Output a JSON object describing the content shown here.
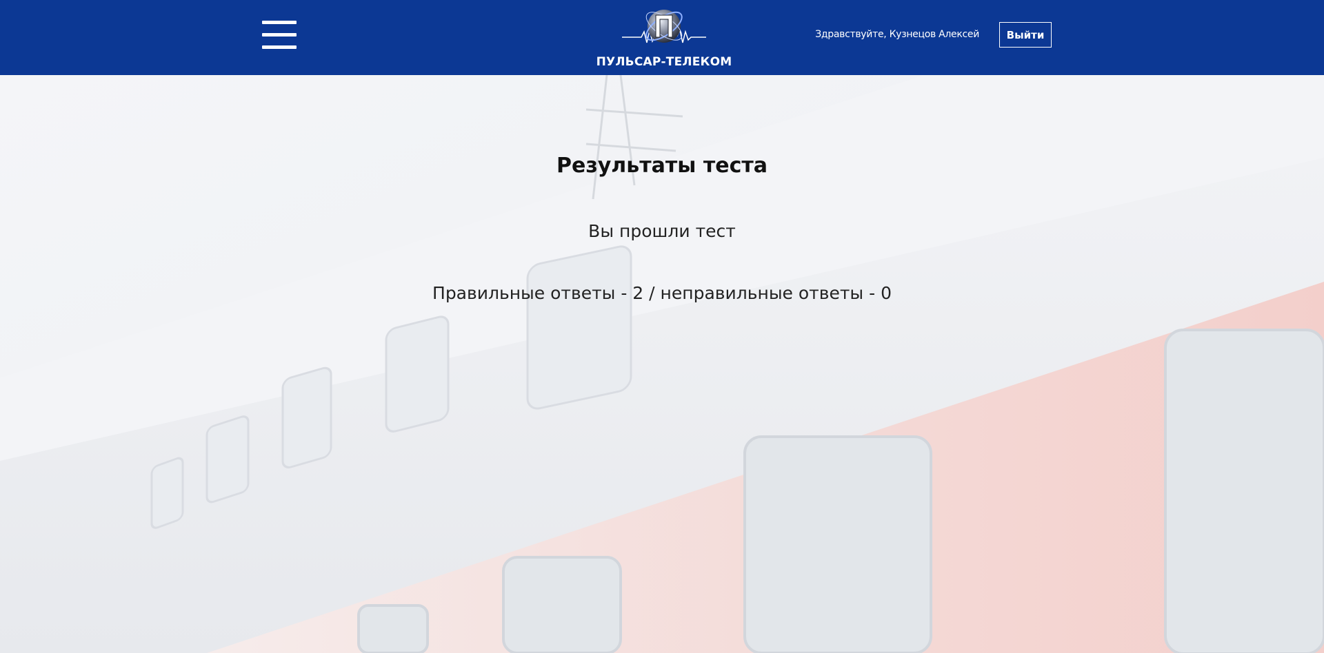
{
  "header": {
    "brand": "ПУЛЬСАР-ТЕЛЕКОМ",
    "greeting": "Здравствуйте, Кузнецов Алексей",
    "logout_label": "Выйти",
    "menu_icon": "hamburger-menu-icon",
    "background_color": "#0c3894"
  },
  "main": {
    "title": "Результаты теста",
    "subtitle": "Вы прошли тест",
    "result": "Правильные ответы - 2 / неправильные ответы - 0"
  }
}
